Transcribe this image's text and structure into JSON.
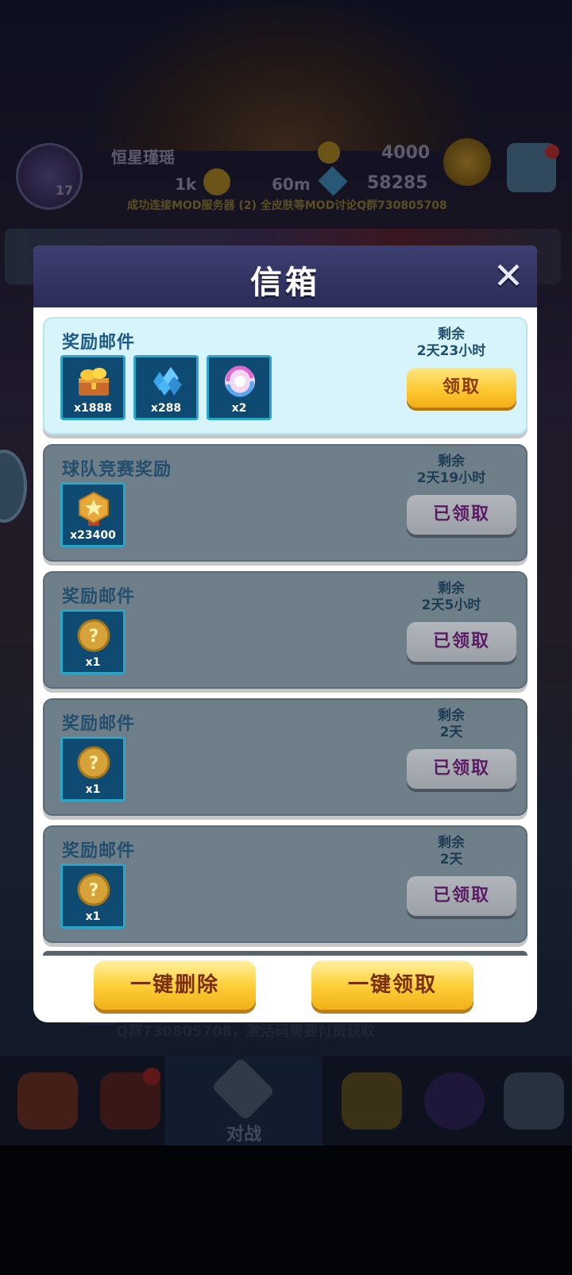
{
  "background": {
    "player_name": "恒星瑾瑶",
    "level": "17",
    "trophies": "4000",
    "coins": "1k",
    "energy": "60m",
    "gems": "58285",
    "notice": "成功连接MOD服务器 (2) 全皮肤等MOD讨论Q群730805708",
    "scroll_message": "Q群730805708，激活码需要付费获取",
    "nav_battle_label": "对战"
  },
  "modal": {
    "title": "信箱",
    "close_icon": "close-icon",
    "remain_label": "剩余",
    "mails": [
      {
        "title": "奖励邮件",
        "remaining": "2天23小时",
        "state": "active",
        "button": "领取",
        "items": [
          {
            "icon": "treasure-chest-icon",
            "qty": "x1888"
          },
          {
            "icon": "blue-gems-icon",
            "qty": "x288"
          },
          {
            "icon": "swirl-orb-icon",
            "qty": "x2"
          }
        ]
      },
      {
        "title": "球队竞赛奖励",
        "remaining": "2天19小时",
        "state": "claimed",
        "button": "已领取",
        "items": [
          {
            "icon": "star-medal-icon",
            "qty": "x23400"
          }
        ]
      },
      {
        "title": "奖励邮件",
        "remaining": "2天5小时",
        "state": "claimed",
        "button": "已领取",
        "items": [
          {
            "icon": "mystery-coin-icon",
            "qty": "x1"
          }
        ]
      },
      {
        "title": "奖励邮件",
        "remaining": "2天",
        "state": "claimed",
        "button": "已领取",
        "items": [
          {
            "icon": "mystery-coin-icon",
            "qty": "x1"
          }
        ]
      },
      {
        "title": "奖励邮件",
        "remaining": "2天",
        "state": "claimed",
        "button": "已领取",
        "items": [
          {
            "icon": "mystery-coin-icon",
            "qty": "x1"
          }
        ]
      }
    ],
    "footer": {
      "delete_all": "一键删除",
      "claim_all": "一键领取"
    }
  },
  "colors": {
    "header": "#2b2c57",
    "active_mail": "#d6f4fa",
    "claimed_mail": "#6f7f8a",
    "gold_button": "#fcc933",
    "claimed_text": "#5b1a63"
  }
}
